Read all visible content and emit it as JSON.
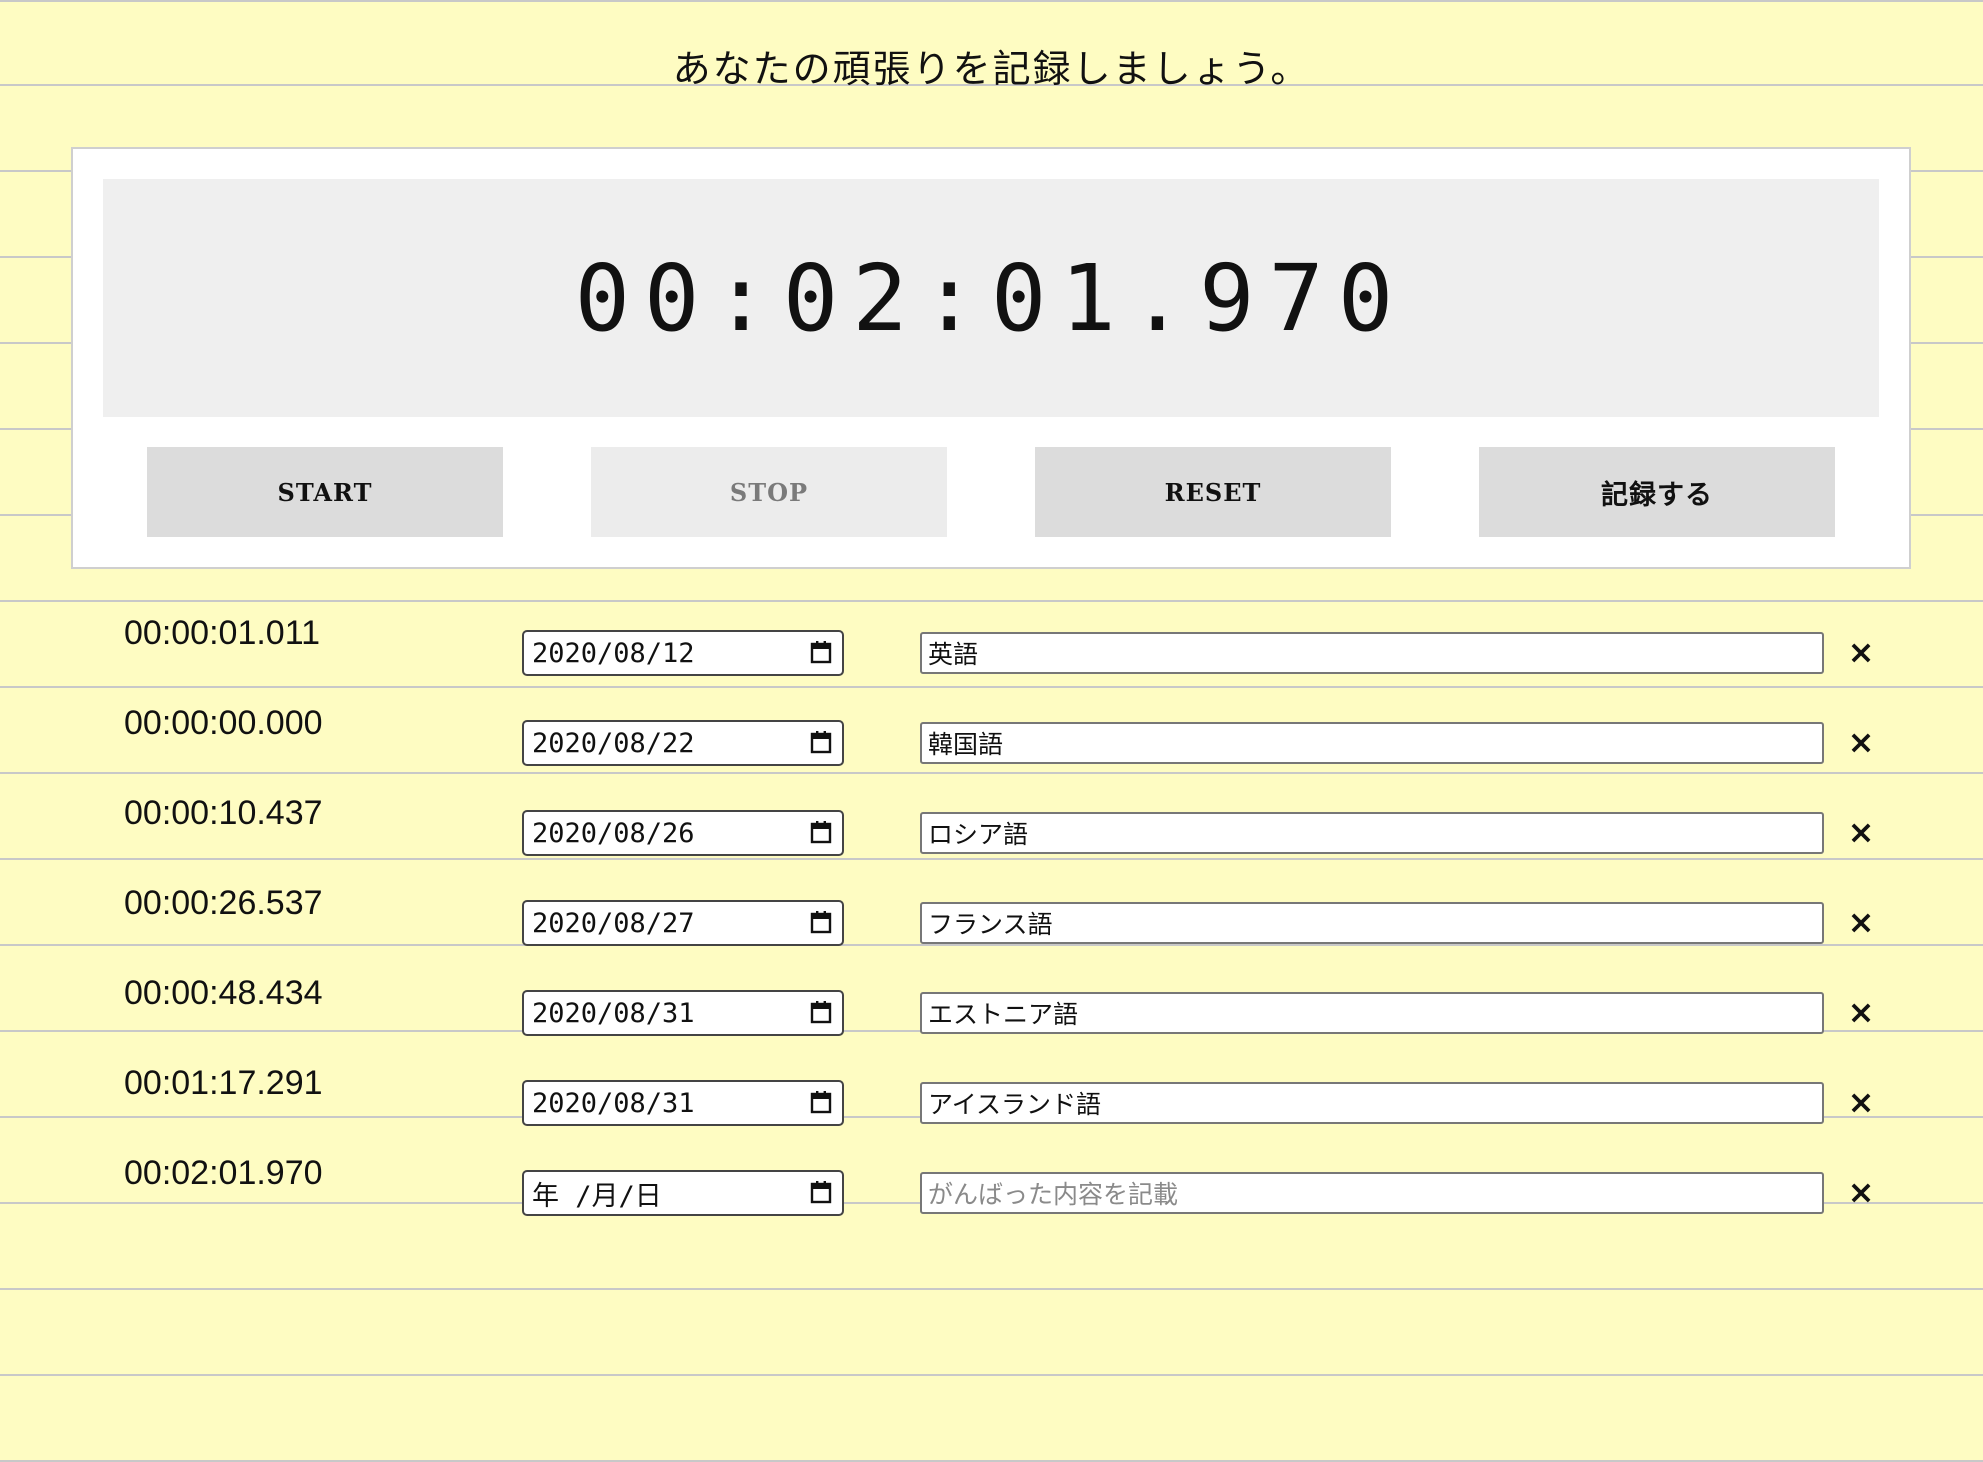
{
  "header": {
    "title": "あなたの頑張りを記録しましょう。"
  },
  "timer": {
    "display": "00:02:01.970"
  },
  "controls": {
    "start_label": "START",
    "stop_label": "STOP",
    "reset_label": "RESET",
    "save_label": "記録する"
  },
  "records": [
    {
      "time": "00:00:01.011",
      "date": "2020/08/12",
      "memo": "英語"
    },
    {
      "time": "00:00:00.000",
      "date": "2020/08/22",
      "memo": "韓国語"
    },
    {
      "time": "00:00:10.437",
      "date": "2020/08/26",
      "memo": "ロシア語"
    },
    {
      "time": "00:00:26.537",
      "date": "2020/08/27",
      "memo": "フランス語"
    },
    {
      "time": "00:00:48.434",
      "date": "2020/08/31",
      "memo": "エストニア語"
    },
    {
      "time": "00:01:17.291",
      "date": "2020/08/31",
      "memo": "アイスランド語"
    },
    {
      "time": "00:02:01.970",
      "date": "年 /月/日",
      "memo": "",
      "memo_placeholder": "がんばった内容を記載"
    }
  ],
  "delete_glyph": "×",
  "icons": {
    "calendar": "calendar-icon",
    "delete": "close-icon"
  },
  "colors": {
    "page_background": "#fefcc2",
    "rule_line": "#c8c8c8",
    "button_background": "#dcdcdc",
    "button_disabled_background": "#ececec"
  }
}
